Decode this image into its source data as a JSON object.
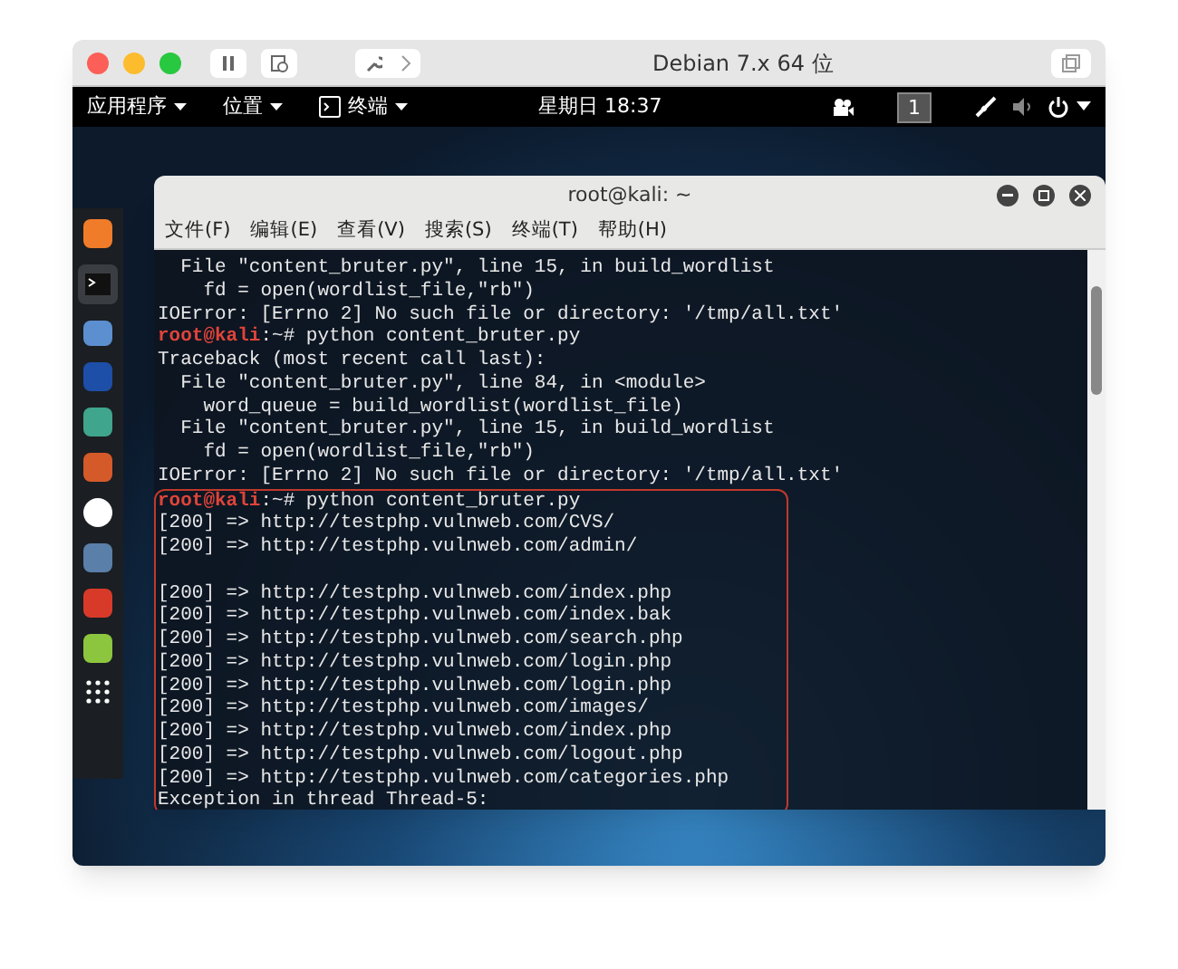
{
  "vm_window": {
    "title": "Debian 7.x 64 位"
  },
  "top_bar": {
    "menus": [
      {
        "label": "应用程序",
        "kind": "menu"
      },
      {
        "label": "位置",
        "kind": "menu"
      },
      {
        "label": "终端",
        "kind": "app"
      }
    ],
    "clock": "星期日 18:37",
    "workspace": "1"
  },
  "terminal": {
    "title": "root@kali: ~",
    "menu": [
      "文件(F)",
      "编辑(E)",
      "查看(V)",
      "搜索(S)",
      "终端(T)",
      "帮助(H)"
    ],
    "lines": [
      {
        "kind": "output",
        "text": "  File \"content_bruter.py\", line 15, in build_wordlist"
      },
      {
        "kind": "output",
        "text": "    fd = open(wordlist_file,\"rb\")"
      },
      {
        "kind": "output",
        "text": "IOError: [Errno 2] No such file or directory: '/tmp/all.txt'"
      },
      {
        "kind": "prompt",
        "user": "root@kali",
        "text": ":~# python content_bruter.py"
      },
      {
        "kind": "output",
        "text": "Traceback (most recent call last):"
      },
      {
        "kind": "output",
        "text": "  File \"content_bruter.py\", line 84, in <module>"
      },
      {
        "kind": "output",
        "text": "    word_queue = build_wordlist(wordlist_file)"
      },
      {
        "kind": "output",
        "text": "  File \"content_bruter.py\", line 15, in build_wordlist"
      },
      {
        "kind": "output",
        "text": "    fd = open(wordlist_file,\"rb\")"
      },
      {
        "kind": "output",
        "text": "IOError: [Errno 2] No such file or directory: '/tmp/all.txt'"
      }
    ],
    "highlighted_lines": [
      {
        "kind": "prompt",
        "user": "root@kali",
        "text": ":~# python content_bruter.py"
      },
      {
        "kind": "output",
        "text": "[200] => http://testphp.vulnweb.com/CVS/"
      },
      {
        "kind": "output",
        "text": "[200] => http://testphp.vulnweb.com/admin/"
      },
      {
        "kind": "blank"
      },
      {
        "kind": "output",
        "text": "[200] => http://testphp.vulnweb.com/index.php"
      },
      {
        "kind": "output",
        "text": "[200] => http://testphp.vulnweb.com/index.bak"
      },
      {
        "kind": "output",
        "text": "[200] => http://testphp.vulnweb.com/search.php"
      },
      {
        "kind": "output",
        "text": "[200] => http://testphp.vulnweb.com/login.php"
      },
      {
        "kind": "output",
        "text": "[200] => http://testphp.vulnweb.com/login.php"
      },
      {
        "kind": "output",
        "text": "[200] => http://testphp.vulnweb.com/images/"
      },
      {
        "kind": "output",
        "text": "[200] => http://testphp.vulnweb.com/index.php"
      },
      {
        "kind": "output",
        "text": "[200] => http://testphp.vulnweb.com/logout.php"
      },
      {
        "kind": "output",
        "text": "[200] => http://testphp.vulnweb.com/categories.php"
      },
      {
        "kind": "output",
        "text": "Exception in thread Thread-5:"
      }
    ]
  }
}
